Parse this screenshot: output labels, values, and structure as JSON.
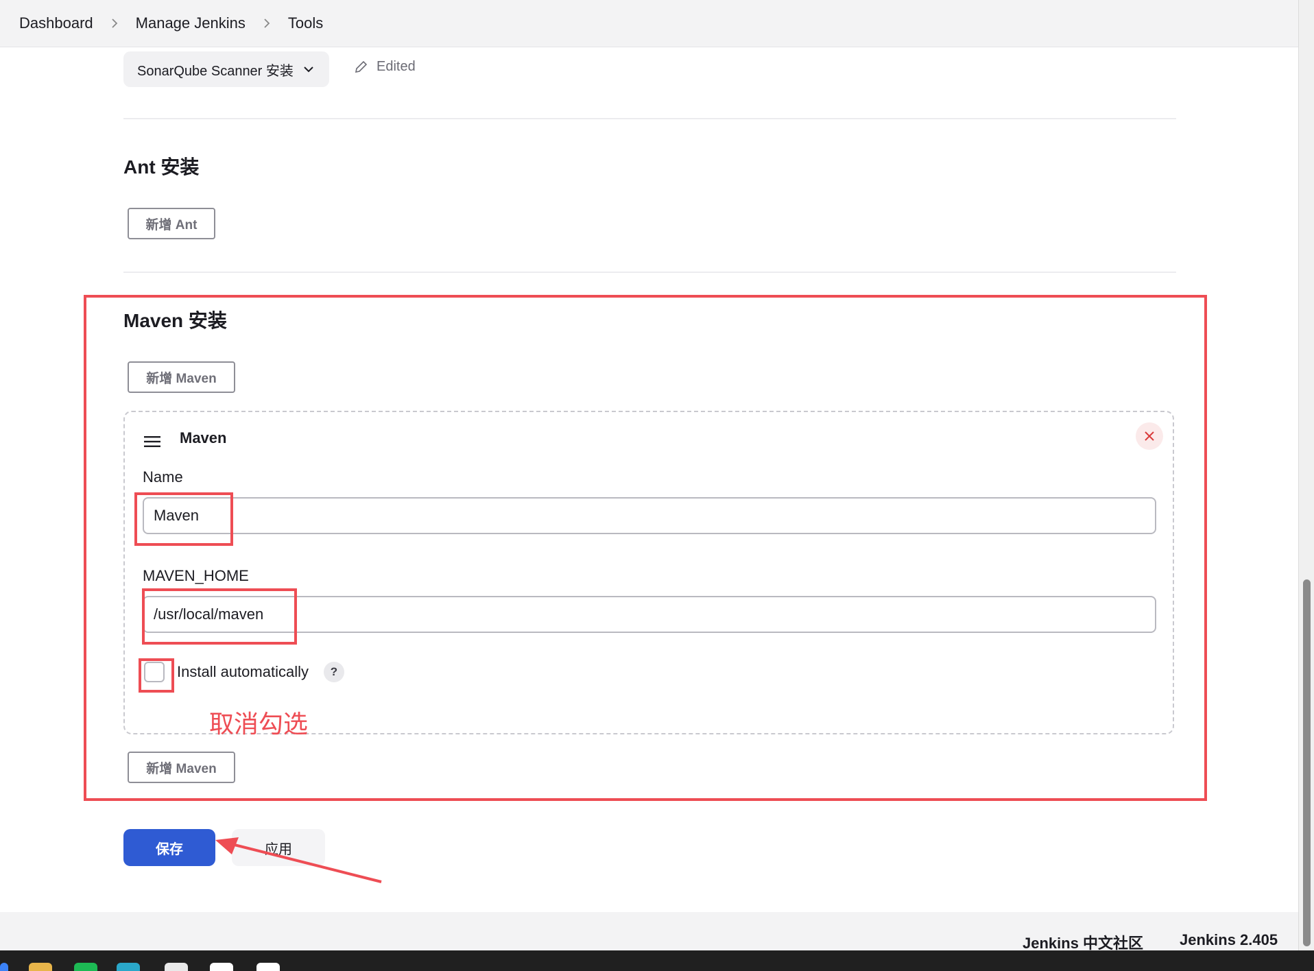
{
  "breadcrumb": [
    "Dashboard",
    "Manage Jenkins",
    "Tools"
  ],
  "sonarqube": {
    "dropdown_label": "SonarQube Scanner 安装",
    "edited_label": "Edited"
  },
  "ant": {
    "title": "Ant 安装",
    "add_button": "新增 Ant"
  },
  "maven": {
    "title": "Maven 安装",
    "add_button_top": "新增 Maven",
    "add_button_bottom": "新增 Maven",
    "card_title": "Maven",
    "name_label": "Name",
    "name_value": "Maven",
    "home_label": "MAVEN_HOME",
    "home_value": "/usr/local/maven",
    "install_auto_label": "Install automatically",
    "install_auto_checked": false,
    "help_icon": "?"
  },
  "actions": {
    "save_label": "保存",
    "apply_label": "应用"
  },
  "annotation": {
    "uncheck_note": "取消勾选"
  },
  "footer": {
    "community_link": "Jenkins 中文社区",
    "version_label": "Jenkins 2.405"
  },
  "colors": {
    "primary": "#2f5bd3",
    "annotation_red": "#ee4d54",
    "close_icon": "#d93a3a"
  }
}
